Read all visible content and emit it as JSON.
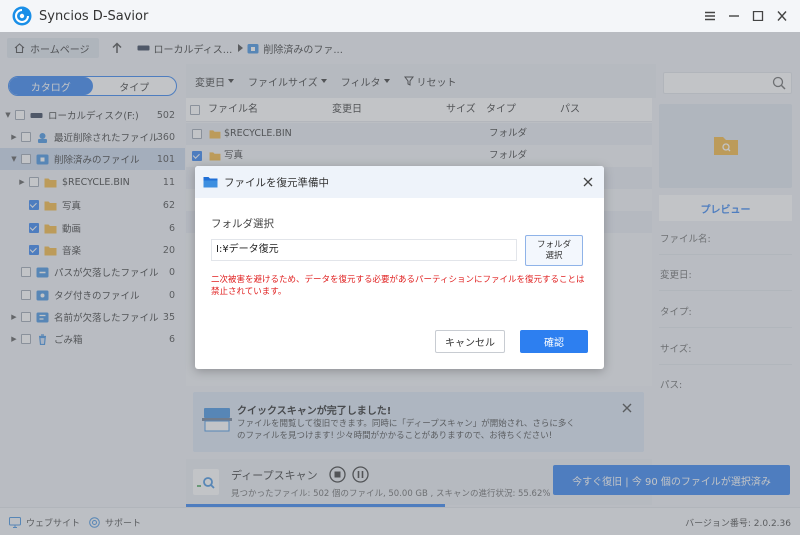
{
  "app": {
    "title": "Syncios D-Savior"
  },
  "nav": {
    "home_label": "ホームページ",
    "crumb1": "ローカルディス...",
    "crumb2": "削除済みのファ..."
  },
  "sidebar": {
    "tab_catalog": "カタログ",
    "tab_type": "タイプ",
    "items": [
      {
        "label": "ローカルディスク(F:)",
        "count": "502",
        "icon": "drive-icon"
      },
      {
        "label": "最近削除されたファイル",
        "count": "360",
        "icon": "recent-deleted-icon"
      },
      {
        "label": "削除済みのファイル",
        "count": "101",
        "icon": "deleted-files-icon"
      },
      {
        "label": "$RECYCLE.BIN",
        "count": "11",
        "icon": "folder-icon"
      },
      {
        "label": "写真",
        "count": "62",
        "icon": "folder-icon"
      },
      {
        "label": "動画",
        "count": "6",
        "icon": "folder-icon"
      },
      {
        "label": "音楽",
        "count": "20",
        "icon": "folder-icon"
      },
      {
        "label": "パスが欠落したファイル",
        "count": "0",
        "icon": "missing-path-icon"
      },
      {
        "label": "タグ付きのファイル",
        "count": "0",
        "icon": "tag-icon"
      },
      {
        "label": "名前が欠落したファイル",
        "count": "35",
        "icon": "missing-name-icon"
      },
      {
        "label": "ごみ箱",
        "count": "6",
        "icon": "trash-icon"
      }
    ]
  },
  "toolbar": {
    "modified": "変更日",
    "filesize": "ファイルサイズ",
    "filter": "フィルタ",
    "reset": "リセット"
  },
  "table": {
    "headers": {
      "name": "ファイル名",
      "modified": "変更日",
      "size": "サイズ",
      "type": "タイプ",
      "path": "パス"
    },
    "rows": [
      {
        "name": "$RECYCLE.BIN",
        "type": "フォルダ"
      },
      {
        "name": "写真",
        "type": "フォルダ"
      }
    ]
  },
  "preview": {
    "button": "プレビュー",
    "labels": {
      "filename": "ファイル名:",
      "modified": "変更日:",
      "type": "タイプ:",
      "size": "サイズ:",
      "path": "パス:"
    }
  },
  "scan_panel": {
    "title": "クイックスキャンが完了しました!",
    "body": "ファイルを閲覧して復旧できます。同時に「ディープスキャン」が開始され、さらに多くのファイルを見つけます! 少々時間がかかることがありますので、お待ちください!"
  },
  "deep_scan": {
    "title": "ディープスキャン",
    "info": "見つかったファイル: 502 個のファイル, 50.00 GB , スキャンの進行状況: 55.62%",
    "progress": 0.5562
  },
  "recover_button": "今すぐ復旧 | 今 90 個のファイルが選択済み",
  "statusbar": {
    "website": "ウェブサイト",
    "support": "サポート",
    "version": "バージョン番号: 2.0.2.36"
  },
  "dialog": {
    "title": "ファイルを復元準備中",
    "folder_label": "フォルダ選択",
    "path_value": "I:¥データ復元",
    "folder_btn_line1": "フォルダ",
    "folder_btn_line2": "選択",
    "warning": "二次被害を避けるため、データを復元する必要があるパーティションにファイルを復元することは禁止されています。",
    "cancel": "キャンセル",
    "confirm": "確認"
  },
  "colors": {
    "accent": "#2d7ff0",
    "warning": "#e02020",
    "folder": "#f5b43a"
  }
}
